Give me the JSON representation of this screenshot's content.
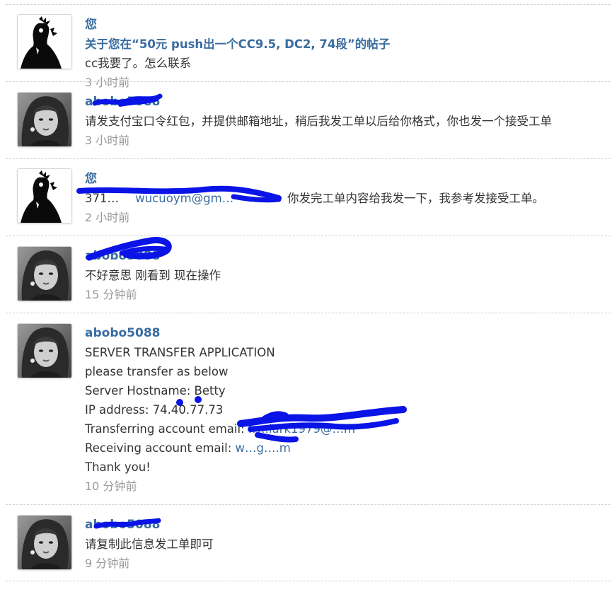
{
  "messages": [
    {
      "author": "您",
      "subject": "关于您在“50元 push出一个CC9.5, DC2, 74段”的帖子",
      "lines": [
        "cc我要了。怎么联系"
      ],
      "time": "3 小时前"
    },
    {
      "author": "abobo5088",
      "lines": [
        "请发支付宝口令红包，并提供邮箱地址，稍后我发工单以后给你格式，你也发一个接受工单"
      ],
      "time": "3 小时前"
    },
    {
      "author": "您",
      "contact_prefix": "371…",
      "contact_email": "wucuoym@gm…",
      "lines": [
        "你发完工单内容给我发一下，我参考发接受工单。"
      ],
      "time": "2 小时前"
    },
    {
      "author": "abobo5088",
      "lines": [
        "不好意思 刚看到 现在操作"
      ],
      "time": "15 分钟前"
    },
    {
      "author": "abobo5088",
      "lines": [
        "SERVER TRANSFER APPLICATION",
        "please transfer as below",
        "Server Hostname: Betty",
        "IP address: 74.40.77.73"
      ],
      "transfer_label": "Transferring account email: ",
      "transfer_email": "fr…lark1979@…m",
      "receive_label": "Receiving account email: ",
      "receive_email": "w…g….m",
      "closing": "Thank you!",
      "time": "10 分钟前"
    },
    {
      "author": "abobo5088",
      "lines": [
        "请复制此信息发工单即可"
      ],
      "time": "9 分钟前"
    }
  ],
  "colors": {
    "author": "#3a6da0",
    "text": "#333333",
    "time": "#999999",
    "redaction": "#0a14e6",
    "divider": "#cfcfcf"
  }
}
